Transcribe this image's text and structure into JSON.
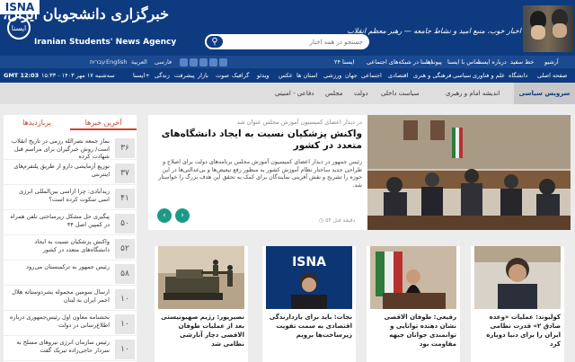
{
  "header": {
    "logo_text": "ISNA",
    "emblem_text": "ایسنا",
    "agency_name_fa": "خبرگزاری دانشجویان ایران، ایسنا",
    "agency_name_en": "Iranian Students' News Agency",
    "slogan": "اخبار خوب، منبع امید و نشاط جامعه — رهبر معظم انقلاب",
    "search_placeholder": "جستجو در همه اخبار"
  },
  "topbar": {
    "items": [
      "آرشیو",
      "خط سفید",
      "درباره ایسنا",
      "تماس با ایسنا",
      "پیوندها",
      "ایسنا در شبکه‌های اجتماعی",
      "ایسنا ۲۴"
    ],
    "languages": [
      "فارسی",
      "العربیة",
      "English",
      "עברית"
    ]
  },
  "mainnav": {
    "date": "سه‌شنبه ۱۷ مهر ۱۴۰۳ - ۱۵:۳۳",
    "clock": "GMT 12:03",
    "items": [
      "صفحه اصلی",
      "دانشگاه",
      "علم و فناوری",
      "سیاسی",
      "فرهنگی و هنری",
      "اقتصادی",
      "اجتماعی",
      "جهان",
      "ورزشی",
      "استان ها",
      "عکس",
      "ویدئو",
      "گرافیک",
      "صوت",
      "بازار",
      "پیشرفت",
      "زندگی",
      "ایسنا+"
    ]
  },
  "breadcrumb": {
    "title": "سرویس سیاسی",
    "items": [
      "اندیشه امام و رهبری",
      "سیاست داخلی",
      "دولت",
      "مجلس",
      "دفاعی - امنیتی"
    ]
  },
  "sidebar": {
    "tab_popular": "پربازدیدها",
    "tab_latest": "آخرین خبرها",
    "items": [
      {
        "num": "۳۶",
        "text": "نماز جمعه نصرالله رزمی در تاریخ انقلاب است/ روش خبرگیران برای مراسم قبل شهادت کرده"
      },
      {
        "num": "۳۷",
        "text": "توزیع آزمایشی دارو از طریق پلتفرم‌های اینترنتی"
      },
      {
        "num": "۴۱",
        "text": "زیدآبادی: چرا ازاسی بین‌المللی انرژی اتمی سکوت کرده است؟"
      },
      {
        "num": "۵۰",
        "text": "پیگیری حل مشکل زیرساختی تلفن همراه در کمپین اصل ۴۴"
      },
      {
        "num": "۵۲",
        "text": "واکنش پزشکیان نسبت به ایجاد دانشگاه‌های متعدد در کشور"
      },
      {
        "num": "۵۸",
        "text": "رئیس جمهور به ترکمنستان می‌رود"
      },
      {
        "num": "۱۰",
        "text": "ارسال سومین محموله بشردوستانه هلال احمر ایران به لبنان"
      },
      {
        "num": "۱۰",
        "text": "بخشنامه معاون اول رئیس‌جمهوری درباره اطلاع‌رسانی در دولت"
      },
      {
        "num": "۱۰",
        "text": "رئیس سازمان انرژی نیروهای مسلح به سردار حاجی‌زاده تبریک گفت"
      }
    ]
  },
  "featured": {
    "kicker": "در دیدار اعضای کمیسیون آموزش مجلس عنوان شد",
    "title": "واکنش پزشکیان نسبت به ایجاد دانشگاه‌های متعدد در کشور",
    "body": "رئیس جمهور در دیدار اعضای کمیسیون آموزش مجلس برنامه‌های دولت برای اصلاح و طراحی جدید ساختار نظام آموزش کشور به منظور رفع تبعیض‌ها و بی‌عدالتی‌ها در این حوزه را تشریح و نقش آفرینی نمایندگان برای کمک به تحقق این هدف بزرگ را خواستار شد.",
    "time": "۵۴ دقیقه قبل",
    "prev_label": "‹",
    "next_label": "›"
  },
  "cards": [
    {
      "title": "کولیوند: عملیات «وعده صادق ۲» قدرت نظامی ایران را برای دنیا دوباره کرد"
    },
    {
      "title": "رفیعی: طوفان الاقصی نشان دهنده توانایی و توانمندی جوانان جبهه مقاومت بود"
    },
    {
      "title": "نجات: باید برای بازدارندگی اقتصادی به سمت تقویت زیرساخت‌ها برویم"
    },
    {
      "title": "نصیرپور: رژیم صهیونیستی بعد از عملیات طوفان الاقصی دچار آنارشی نظامی شد"
    }
  ]
}
